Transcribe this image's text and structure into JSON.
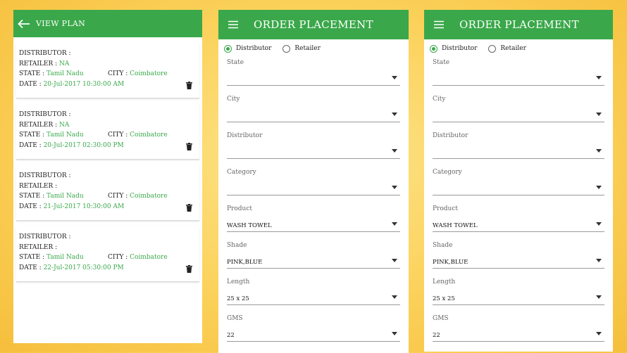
{
  "view_plan": {
    "title": "VIEW PLAN",
    "labels": {
      "distributor": "DISTRIBUTOR :",
      "retailer": "RETAILER :",
      "state": "STATE :",
      "city": "CITY :",
      "date": "DATE :"
    },
    "plans": [
      {
        "retailer": "NA",
        "state": "Tamil Nadu",
        "city": "Coimbatore",
        "date": "20-Jul-2017 10:30:00 AM"
      },
      {
        "retailer": "NA",
        "state": "Tamil Nadu",
        "city": "Coimbatore",
        "date": "20-Jul-2017 02:30:00 PM"
      },
      {
        "retailer": "",
        "state": "Tamil Nadu",
        "city": "Coimbatore",
        "date": "21-Jul-2017 10:30:00 AM"
      },
      {
        "retailer": "",
        "state": "Tamil Nadu",
        "city": "Coimbatore",
        "date": "22-Jul-2017 05:30:00 PM"
      }
    ]
  },
  "order_forms": [
    {
      "title": "ORDER PLACEMENT",
      "radios": [
        {
          "label": "Distributor",
          "selected": true
        },
        {
          "label": "Retailer",
          "selected": false
        }
      ],
      "fields": [
        {
          "label": "State",
          "value": ""
        },
        {
          "label": "City",
          "value": ""
        },
        {
          "label": "Distributor",
          "value": ""
        },
        {
          "label": "Category",
          "value": ""
        },
        {
          "label": "Product",
          "value": "WASH TOWEL"
        },
        {
          "label": "Shade",
          "value": "PINK,BLUE"
        },
        {
          "label": "Length",
          "value": "25 x 25"
        },
        {
          "label": "GMS",
          "value": "22"
        }
      ]
    },
    {
      "title": "ORDER PLACEMENT",
      "radios": [
        {
          "label": "Distributor",
          "selected": true
        },
        {
          "label": "Retailer",
          "selected": false
        }
      ],
      "fields": [
        {
          "label": "State",
          "value": ""
        },
        {
          "label": "City",
          "value": ""
        },
        {
          "label": "Distributor",
          "value": ""
        },
        {
          "label": "Category",
          "value": ""
        },
        {
          "label": "Product",
          "value": "WASH TOWEL"
        },
        {
          "label": "Shade",
          "value": "PINK,BLUE"
        },
        {
          "label": "Length",
          "value": "25 x 25"
        },
        {
          "label": "GMS",
          "value": "22"
        }
      ]
    }
  ],
  "colors": {
    "accent": "#3aa84a",
    "background": "#fbd15a"
  },
  "icons": {
    "back": "arrow-left-icon",
    "menu": "hamburger-menu-icon",
    "delete": "trash-icon",
    "dropdown": "caret-down-icon"
  }
}
